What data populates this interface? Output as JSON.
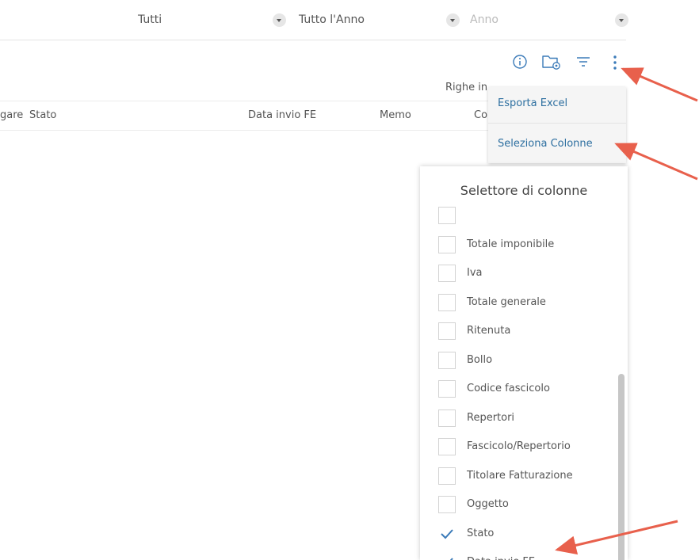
{
  "filters": {
    "first_value": "Tutti",
    "second_value": "Tutto l'Anno",
    "third_placeholder": "Anno"
  },
  "toolbar": {
    "icons": [
      "info-icon",
      "folder-settings-icon",
      "filter-icon",
      "more-vertical-icon"
    ]
  },
  "rows_label": "Righe in",
  "table": {
    "columns": [
      "gare",
      "Stato",
      "Data invio FE",
      "Memo",
      "Co"
    ]
  },
  "menu": {
    "items": [
      {
        "label": "Esporta Excel"
      },
      {
        "label": "Seleziona Colonne"
      }
    ]
  },
  "column_selector": {
    "title": "Selettore di colonne",
    "items": [
      {
        "label": "",
        "checked": false
      },
      {
        "label": "Totale imponibile",
        "checked": false
      },
      {
        "label": "Iva",
        "checked": false
      },
      {
        "label": "Totale generale",
        "checked": false
      },
      {
        "label": "Ritenuta",
        "checked": false
      },
      {
        "label": "Bollo",
        "checked": false
      },
      {
        "label": "Codice fascicolo",
        "checked": false
      },
      {
        "label": "Repertori",
        "checked": false
      },
      {
        "label": "Fascicolo/Repertorio",
        "checked": false
      },
      {
        "label": "Titolare Fatturazione",
        "checked": false
      },
      {
        "label": "Oggetto",
        "checked": false
      },
      {
        "label": "Stato",
        "checked": true
      },
      {
        "label": "Data invio FE",
        "checked": true
      }
    ]
  },
  "colors": {
    "accent": "#2d6fa0",
    "arrow": "#e8604c",
    "check": "#3a7ab8"
  }
}
